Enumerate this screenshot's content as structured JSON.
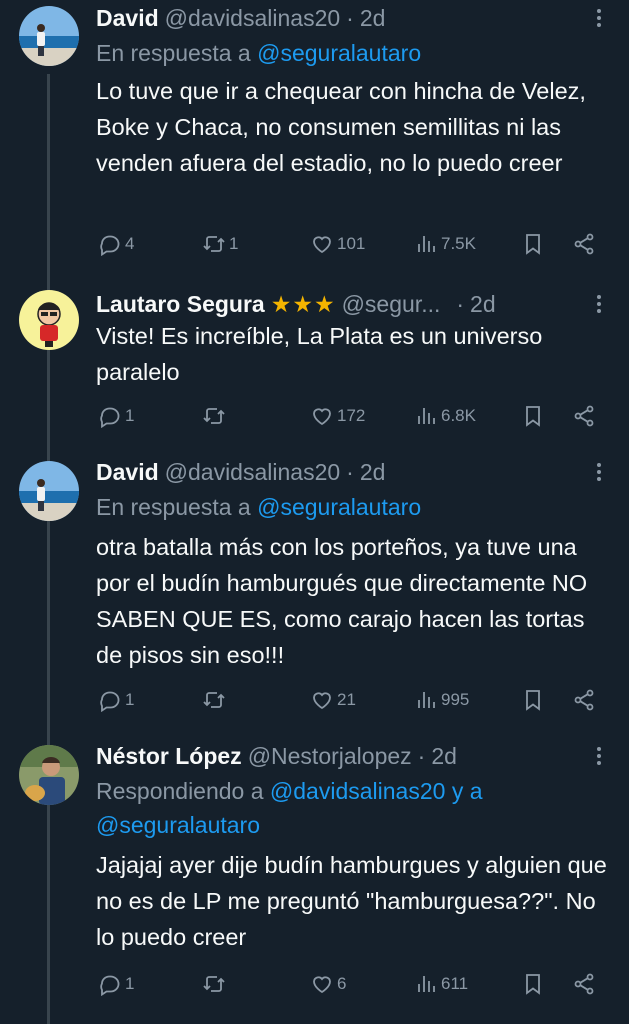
{
  "tweets": [
    {
      "name": "David",
      "handle": "@davidsalinas20",
      "dot": "·",
      "time": "2d",
      "reply_prefix": "En respuesta a ",
      "reply_mentions": "@seguralautaro",
      "reply_line2": "",
      "body": "Lo tuve que ir a chequear con hincha de Velez, Boke y Chaca, no consumen semillitas ni las venden afuera del estadio, no lo puedo creer",
      "replies": "4",
      "retweets": "1",
      "likes": "101",
      "views": "7.5K"
    },
    {
      "name": "Lautaro Segura",
      "stars": "★★★",
      "handle": "@segur...",
      "dot": "·",
      "time": "2d",
      "body": "Viste! Es increíble, La Plata es un universo paralelo",
      "replies": "1",
      "retweets": "",
      "likes": "172",
      "views": "6.8K"
    },
    {
      "name": "David",
      "handle": "@davidsalinas20",
      "dot": "·",
      "time": "2d",
      "reply_prefix": "En respuesta a ",
      "reply_mentions": "@seguralautaro",
      "body": "otra batalla más con los porteños, ya tuve una por el budín hamburgués que directamente NO SABEN QUE ES, como carajo hacen las tortas de pisos sin eso!!!",
      "replies": "1",
      "retweets": "",
      "likes": "21",
      "views": "995"
    },
    {
      "name": "Néstor López",
      "handle": "@Nestorjalopez",
      "dot": "·",
      "time": "2d",
      "reply_prefix": "Respondiendo a ",
      "reply_mentions": "@davidsalinas20 y a",
      "reply_line2": "@seguralautaro",
      "body": "Jajajaj ayer dije budín hamburgues y alguien que no es de LP me preguntó \"hamburguesa??\". No lo puedo creer",
      "replies": "1",
      "retweets": "",
      "likes": "6",
      "views": "611"
    }
  ],
  "colors": {
    "background": "#15202b",
    "text": "#f7f9f9",
    "secondary": "#8b98a5",
    "link": "#1d9bf0",
    "stars": "#f4b400"
  },
  "icons": [
    "reply-icon",
    "retweet-icon",
    "like-icon",
    "views-icon",
    "bookmark-icon",
    "share-icon",
    "more-icon"
  ]
}
